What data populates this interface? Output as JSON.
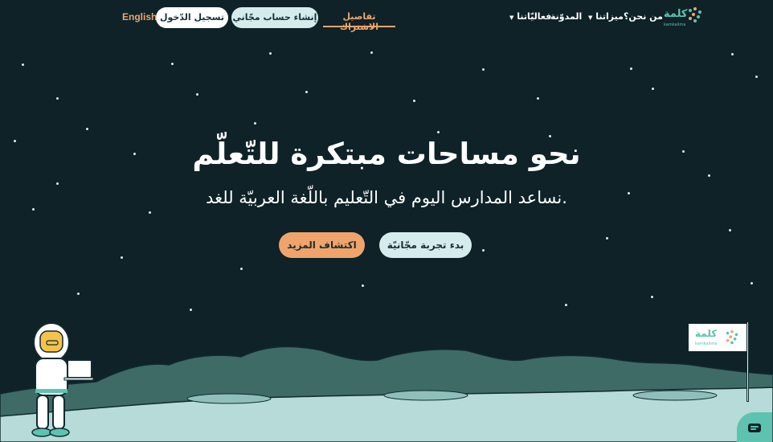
{
  "header": {
    "logo": {
      "word": "كلمة",
      "sub": "kamkalima"
    },
    "nav": {
      "about": "من نحن؟",
      "features": "ميزاتنا",
      "blog": "المدوّنة",
      "events": "فعاليّاتنا"
    },
    "subscription_link": "تفاصيل الاشتراك",
    "create_account": "إنشاء حساب مجّاني",
    "login": "تسجيل الدّخول",
    "language": "English"
  },
  "hero": {
    "title": "نحو مساحات مبتكرة للتّعلّم",
    "subtitle": "نساعد المدارس اليوم في التّعليم باللّغة العربيّة للغد.",
    "free_trial": "بدء تجربة مجّانيّة",
    "explore": "اكتشاف المزيد"
  },
  "flag": {
    "word": "كلمة",
    "sub": "kamkalima"
  },
  "colors": {
    "background": "#0e2228",
    "accent_orange": "#f0a46c",
    "accent_teal": "#5dc3b0",
    "pill_light": "#d6ecec",
    "moon_surface": "#b6dbd8",
    "mountains": "#3e6b66"
  },
  "icons": {
    "chat": "chat-bubble-icon",
    "logo_dots": "dot-cluster-icon"
  }
}
